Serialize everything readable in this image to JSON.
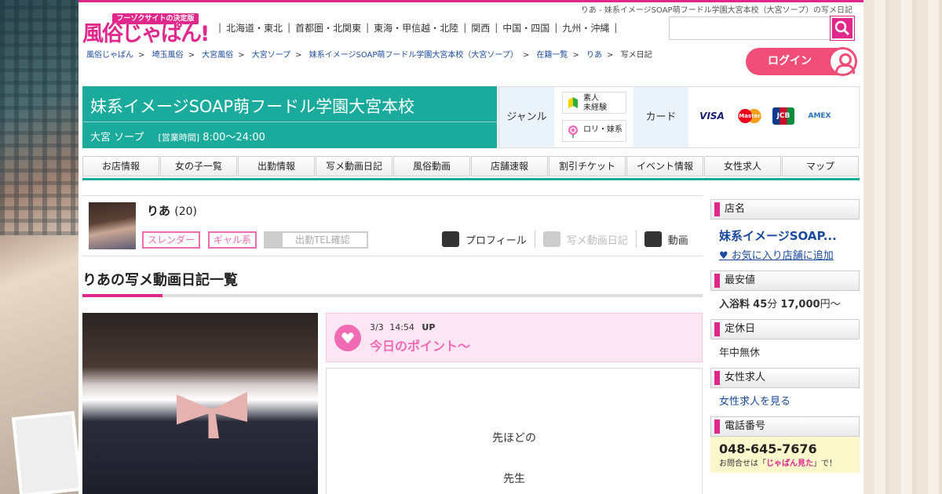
{
  "page_title_bar": "りあ - 妹系イメージSOAP萌フードル学園大宮本校（大宮ソープ）の写メ日記",
  "logo": {
    "tagline": "フーゾクサイトの決定版",
    "name": "風俗じゃぱん!"
  },
  "regions": [
    "北海道・東北",
    "首都圏・北関東",
    "東海・甲信越・北陸",
    "関西",
    "中国・四国",
    "九州・沖縄"
  ],
  "search": {
    "placeholder": ""
  },
  "breadcrumb": [
    "風俗じゃぱん",
    "埼玉風俗",
    "大宮風俗",
    "大宮ソープ",
    "妹系イメージSOAP萌フードル学園大宮本校（大宮ソープ）",
    "在籍一覧",
    "りあ",
    "写メ日記"
  ],
  "login_label": "ログイン",
  "shop": {
    "name": "妹系イメージSOAP萌フードル学園大宮本校",
    "area": "大宮 ソープ",
    "hours_label": "[営業時間]",
    "hours": "8:00～24:00"
  },
  "genre": {
    "label": "ジャンル",
    "tags": [
      "素人\n未経験",
      "ロリ・妹系"
    ],
    "card_label": "カード",
    "cards": [
      "VISA",
      "Master",
      "JCB",
      "AMEX"
    ]
  },
  "nav": [
    "お店情報",
    "女の子一覧",
    "出勤情報",
    "写メ動画日記",
    "風俗動画",
    "店舗速報",
    "割引チケット",
    "イベント情報",
    "女性求人",
    "マップ"
  ],
  "girl": {
    "name": "りあ",
    "age": "(20)",
    "badges": [
      "スレンダー",
      "ギャル系"
    ],
    "tel_label": "出勤TEL確認",
    "actions": [
      "プロフィール",
      "写メ動画日記",
      "動画"
    ]
  },
  "list_heading": "りあの写メ動画日記一覧",
  "diary": {
    "date": "3/3",
    "time": "14:54",
    "up": "UP",
    "title": "今日のポイント〜",
    "lines": [
      "先ほどの",
      "先生"
    ]
  },
  "sidebar": {
    "shop_label": "店名",
    "shop_name": "妹系イメージSOAP...",
    "fav": "♥ お気に入り店舗に追加",
    "price_label": "最安値",
    "price_prefix": "入浴料",
    "price_min": "45",
    "price_min_unit": "分",
    "price": "17,000",
    "price_suffix": "円～",
    "holiday_label": "定休日",
    "holiday": "年中無休",
    "recruit_label": "女性求人",
    "recruit_link": "女性求人を見る",
    "phone_label": "電話番号",
    "phone": "048-645-7676",
    "phone_note_pre": "お問合せは「",
    "phone_note_key": "じゃぱん見た",
    "phone_note_post": "」で！"
  },
  "colors": {
    "brand_pink": "#e0288c",
    "teal": "#1aab9c",
    "link_blue": "#1a4a9e"
  }
}
